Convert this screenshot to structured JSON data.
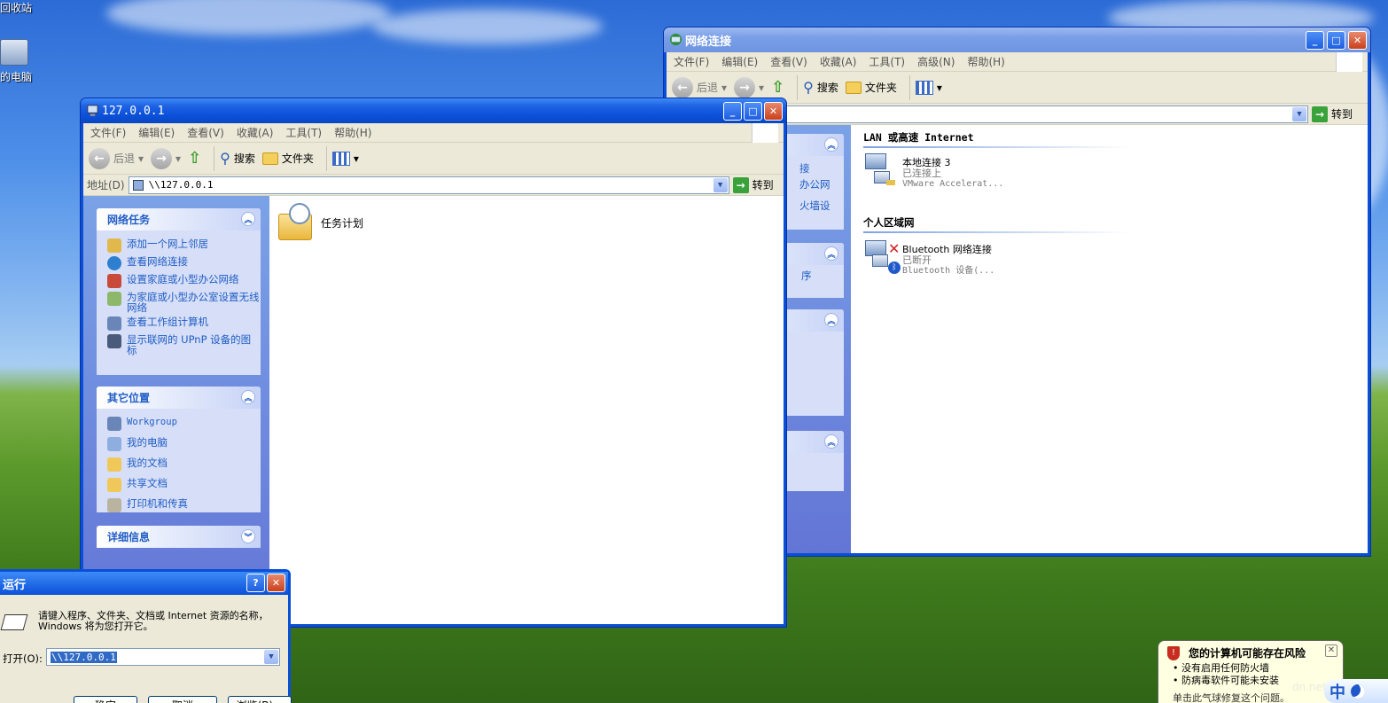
{
  "desktop": {
    "recycle_bin_label": "回收站",
    "my_computer_label": "的电脑"
  },
  "explorer_window": {
    "title": "127.0.0.1",
    "menu": [
      "文件(F)",
      "编辑(E)",
      "查看(V)",
      "收藏(A)",
      "工具(T)",
      "帮助(H)"
    ],
    "toolbar": {
      "back": "后退",
      "search": "搜索",
      "folders": "文件夹"
    },
    "address": {
      "label": "地址(D)",
      "value": "\\\\127.0.0.1",
      "go": "转到"
    },
    "network_tasks": {
      "header": "网络任务",
      "items": [
        "添加一个网上邻居",
        "查看网络连接",
        "设置家庭或小型办公网络",
        "为家庭或小型办公室设置无线网络",
        "查看工作组计算机",
        "显示联网的 UPnP 设备的图标"
      ]
    },
    "other_places": {
      "header": "其它位置",
      "items": [
        "Workgroup",
        "我的电脑",
        "我的文档",
        "共享文档",
        "打印机和传真"
      ]
    },
    "details": {
      "header": "详细信息"
    },
    "files": [
      {
        "name": "任务计划"
      }
    ]
  },
  "network_window": {
    "title": "网络连接",
    "menu": [
      "文件(F)",
      "编辑(E)",
      "查看(V)",
      "收藏(A)",
      "工具(T)",
      "高级(N)",
      "帮助(H)"
    ],
    "toolbar": {
      "back": "后退",
      "search": "搜索",
      "folders": "文件夹"
    },
    "go": "转到",
    "partial_task_links": [
      "接",
      "办公网",
      "火墙设"
    ],
    "partial_link_2": "序",
    "sections": [
      {
        "header": "LAN 或高速 Internet",
        "items": [
          {
            "name": "本地连接 3",
            "status": "已连接上",
            "device": "VMware Accelerat..."
          }
        ]
      },
      {
        "header": "个人区域网",
        "items": [
          {
            "name": "Bluetooth 网络连接",
            "status": "已断开",
            "device": "Bluetooth 设备(..."
          }
        ]
      }
    ]
  },
  "run_dialog": {
    "title": "运行",
    "description": "请键入程序、文件夹、文档或 Internet 资源的名称，Windows 将为您打开它。",
    "open_label": "打开(O):",
    "open_value": "\\\\127.0.0.1",
    "buttons": [
      "确定",
      "取消",
      "浏览(B)..."
    ]
  },
  "security_balloon": {
    "title": "您的计算机可能存在风险",
    "items": [
      "防火墙",
      "防病毒软件可能未安装"
    ],
    "items_prefix": [
      "没有启用任何",
      ""
    ],
    "footer": "单击此气球修复这个问题。"
  },
  "tray": {
    "ime": "中",
    "watermark": "dn.net/..."
  }
}
